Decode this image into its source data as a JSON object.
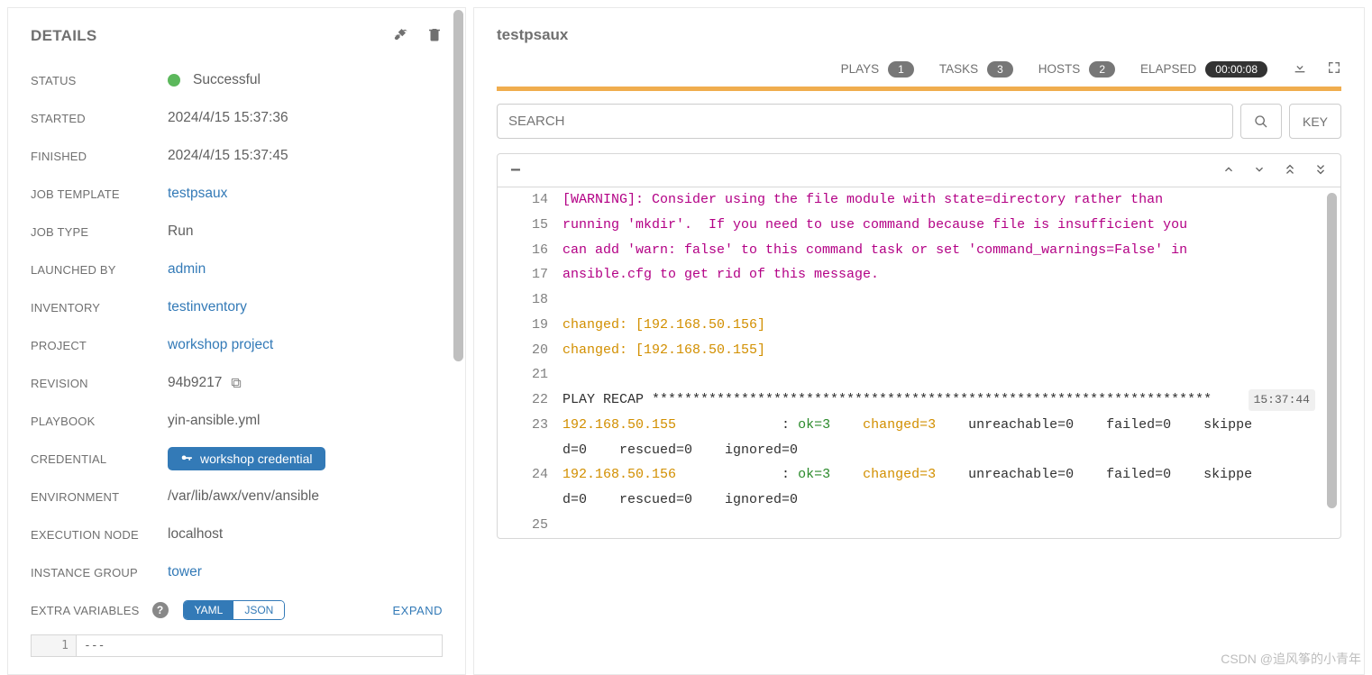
{
  "left": {
    "title": "DETAILS",
    "status_label": "STATUS",
    "status_value": "Successful",
    "started_label": "STARTED",
    "started_value": "2024/4/15 15:37:36",
    "finished_label": "FINISHED",
    "finished_value": "2024/4/15 15:37:45",
    "template_label": "JOB TEMPLATE",
    "template_value": "testpsaux",
    "jobtype_label": "JOB TYPE",
    "jobtype_value": "Run",
    "launchedby_label": "LAUNCHED BY",
    "launchedby_value": "admin",
    "inventory_label": "INVENTORY",
    "inventory_value": "testinventory",
    "project_label": "PROJECT",
    "project_value": "workshop project",
    "revision_label": "REVISION",
    "revision_value": "94b9217",
    "playbook_label": "PLAYBOOK",
    "playbook_value": "yin-ansible.yml",
    "credential_label": "CREDENTIAL",
    "credential_value": "workshop credential",
    "environment_label": "ENVIRONMENT",
    "environment_value": "/var/lib/awx/venv/ansible",
    "execnode_label": "EXECUTION NODE",
    "execnode_value": "localhost",
    "instancegroup_label": "INSTANCE GROUP",
    "instancegroup_value": "tower",
    "extravars_label": "EXTRA VARIABLES",
    "yaml": "YAML",
    "json": "JSON",
    "expand": "EXPAND",
    "vars_line_num": "1",
    "vars_content": "---"
  },
  "right": {
    "title": "testpsaux",
    "plays_label": "PLAYS",
    "plays_count": "1",
    "tasks_label": "TASKS",
    "tasks_count": "3",
    "hosts_label": "HOSTS",
    "hosts_count": "2",
    "elapsed_label": "ELAPSED",
    "elapsed_value": "00:00:08",
    "search_placeholder": "SEARCH",
    "key_label": "KEY",
    "lines": {
      "l14": "[WARNING]: Consider using the file module with state=directory rather than",
      "l15": "running 'mkdir'.  If you need to use command because file is insufficient you",
      "l16": "can add 'warn: false' to this command task or set 'command_warnings=False' in",
      "l17": "ansible.cfg to get rid of this message.",
      "l19": "changed: [192.168.50.156]",
      "l20": "changed: [192.168.50.155]",
      "l22": "PLAY RECAP *********************************************************************",
      "l22_time": "15:37:44",
      "l23_host": "192.168.50.155",
      "l23_sep": "             : ",
      "l23_ok": "ok=3   ",
      "l23_ch": " changed=3   ",
      "l23_rest": " unreachable=0    failed=0    skipped=0    rescued=0    ignored=0",
      "l24_host": "192.168.50.156",
      "l24_sep": "             : ",
      "l24_ok": "ok=3   ",
      "l24_ch": " changed=3   ",
      "l24_rest": " unreachable=0    failed=0    skipped=0    rescued=0    ignored=0"
    },
    "nums": {
      "n14": "14",
      "n15": "15",
      "n16": "16",
      "n17": "17",
      "n18": "18",
      "n19": "19",
      "n20": "20",
      "n21": "21",
      "n22": "22",
      "n23": "23",
      "n24": "24",
      "n25": "25"
    }
  },
  "watermark": "CSDN @追风筝的小青年"
}
